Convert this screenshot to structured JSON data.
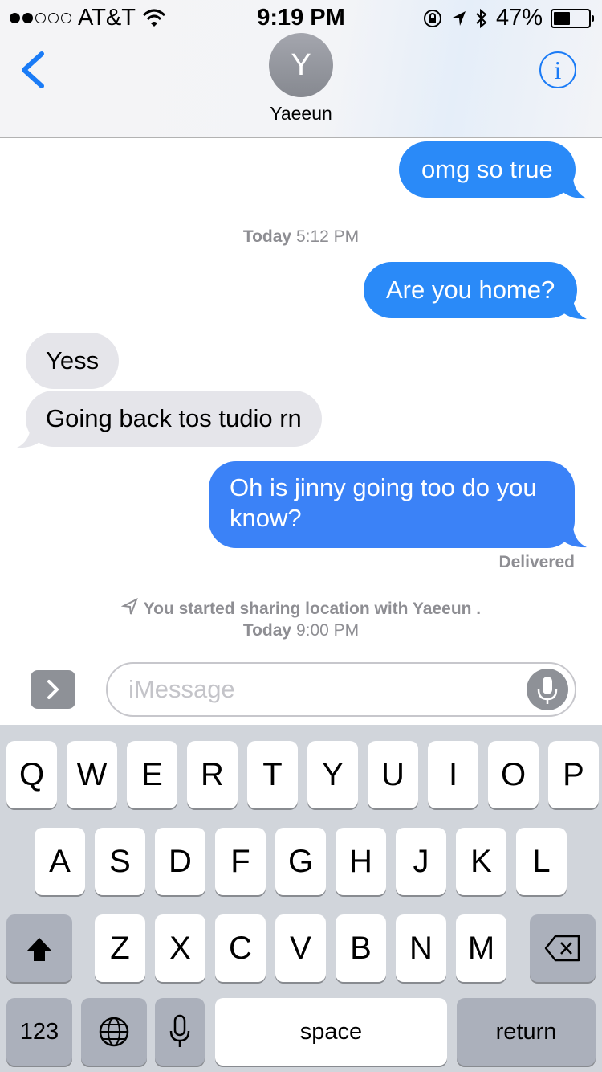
{
  "status_bar": {
    "carrier": "AT&T",
    "time": "9:19 PM",
    "battery_percent": "47%",
    "battery_level": 0.47,
    "signal_bars_filled": 2,
    "signal_bars_total": 5,
    "icons": [
      "wifi-icon",
      "orientation-lock-icon",
      "location-arrow-icon",
      "bluetooth-icon",
      "battery-icon"
    ]
  },
  "header": {
    "avatar_initial": "Y",
    "contact_name": "Yaeeun",
    "back_icon": "chevron-left-icon",
    "info_icon": "info-icon",
    "info_glyph": "i"
  },
  "conversation": {
    "messages": [
      {
        "from": "me",
        "text": "omg so true"
      },
      {
        "type": "timestamp",
        "day": "Today",
        "time": "5:12 PM"
      },
      {
        "from": "me",
        "text": "Are you home?"
      },
      {
        "from": "them",
        "text": "Yess"
      },
      {
        "from": "them",
        "text": "Going back tos tudio rn"
      },
      {
        "from": "me",
        "lines": [
          "Oh is jinny going too do you",
          "know?"
        ]
      }
    ],
    "delivered_label": "Delivered",
    "location_notice": {
      "text": "You started sharing location with Yaeeun .",
      "day": "Today",
      "time": "9:00 PM"
    }
  },
  "composer": {
    "placeholder": "iMessage",
    "expand_icon": "chevron-right-icon",
    "mic_icon": "microphone-icon"
  },
  "keyboard": {
    "row1": [
      "Q",
      "W",
      "E",
      "R",
      "T",
      "Y",
      "U",
      "I",
      "O",
      "P"
    ],
    "row2": [
      "A",
      "S",
      "D",
      "F",
      "G",
      "H",
      "J",
      "K",
      "L"
    ],
    "row3": [
      "Z",
      "X",
      "C",
      "V",
      "B",
      "N",
      "M"
    ],
    "numbers_label": "123",
    "space_label": "space",
    "return_label": "return",
    "shift_icon": "shift-icon",
    "delete_icon": "delete-icon",
    "globe_icon": "globe-icon",
    "dictation_icon": "microphone-icon"
  },
  "colors": {
    "imessage_blue": "#2a8af8",
    "received_gray": "#e5e5ea",
    "keyboard_bg": "#d1d5db",
    "accent": "#1a7bf6"
  }
}
